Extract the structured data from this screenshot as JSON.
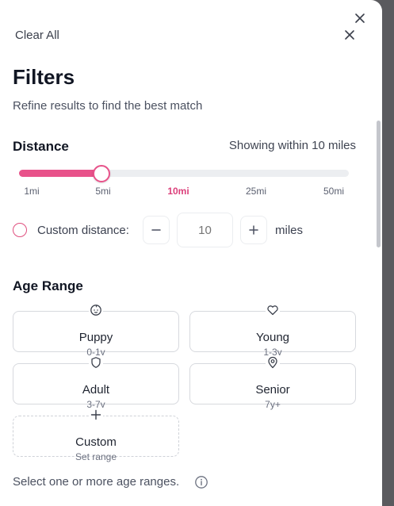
{
  "header": {
    "clear_all": "Clear All",
    "title": "Filters",
    "subtitle": "Refine results to find the best match"
  },
  "distance": {
    "section_title": "Distance",
    "status": "Showing within 10 miles",
    "selected_fraction": 0.25,
    "ticks": [
      "1mi",
      "5mi",
      "10mi",
      "25mi",
      "50mi"
    ],
    "active_tick": "10mi",
    "custom_label": "Custom distance:",
    "custom_placeholder": "10",
    "unit_label": "miles"
  },
  "age_range": {
    "section_title": "Age Range",
    "options": [
      {
        "label": "Puppy",
        "sub": "0-1y",
        "icon": "baby-face-icon"
      },
      {
        "label": "Young",
        "sub": "1-3y",
        "icon": "heart-icon"
      },
      {
        "label": "Adult",
        "sub": "3-7y",
        "icon": "shield-icon"
      },
      {
        "label": "Senior",
        "sub": "7y+",
        "icon": "map-pin-icon"
      },
      {
        "label": "Custom",
        "sub": "Set range",
        "icon": "plus-icon"
      }
    ],
    "help": "Select one or more age ranges."
  },
  "colors": {
    "accent": "#e8528a",
    "track": "#eceef1",
    "border": "#d7d9de"
  }
}
